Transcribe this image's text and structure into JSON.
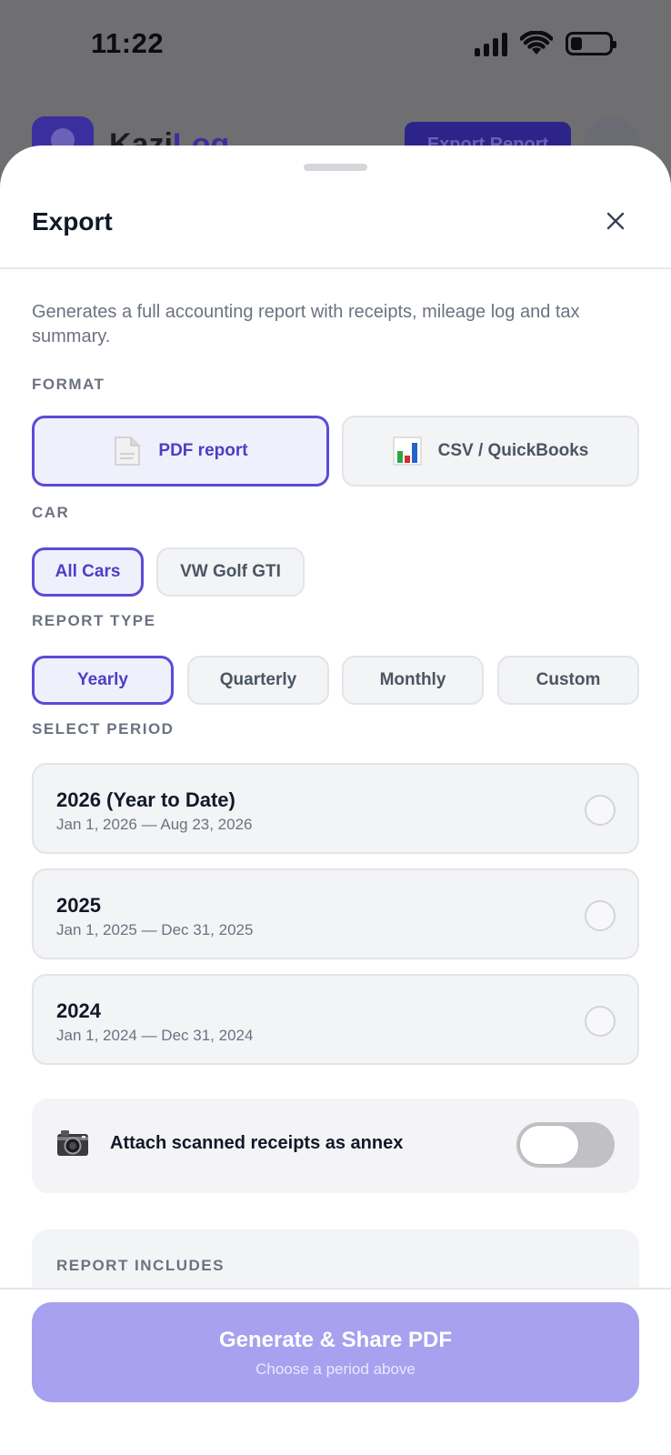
{
  "status_bar": {
    "time": "11:22"
  },
  "background_app": {
    "brand_prefix": "Kazi",
    "brand_suffix": "Log",
    "export_button": "Export Report"
  },
  "sheet": {
    "title": "Export",
    "description": "Generates a full accounting report with receipts, mileage log and tax summary."
  },
  "format": {
    "label": "FORMAT",
    "options": [
      {
        "label": "PDF report",
        "icon": "document-icon",
        "selected": true
      },
      {
        "label": "CSV / QuickBooks",
        "icon": "bar-chart-icon",
        "selected": false
      }
    ]
  },
  "car": {
    "label": "CAR",
    "options": [
      {
        "label": "All Cars",
        "selected": true
      },
      {
        "label": "VW Golf GTI",
        "selected": false
      }
    ]
  },
  "report_type": {
    "label": "REPORT TYPE",
    "options": [
      {
        "label": "Yearly",
        "selected": true
      },
      {
        "label": "Quarterly",
        "selected": false
      },
      {
        "label": "Monthly",
        "selected": false
      },
      {
        "label": "Custom",
        "selected": false
      }
    ]
  },
  "period": {
    "label": "SELECT PERIOD",
    "options": [
      {
        "title": "2026 (Year to Date)",
        "range": "Jan 1, 2026 — Aug 23, 2026",
        "selected": false
      },
      {
        "title": "2025",
        "range": "Jan 1, 2025 — Dec 31, 2025",
        "selected": false
      },
      {
        "title": "2024",
        "range": "Jan 1, 2024 — Dec 31, 2024",
        "selected": false
      }
    ]
  },
  "annex": {
    "icon": "camera-icon",
    "label": "Attach scanned receipts as annex",
    "enabled": false
  },
  "includes": {
    "label": "REPORT INCLUDES"
  },
  "footer": {
    "button_title": "Generate & Share PDF",
    "button_subtitle": "Choose a period above"
  },
  "colors": {
    "accent": "#5b4bd6",
    "button_disabled": "#a7a1ef"
  }
}
